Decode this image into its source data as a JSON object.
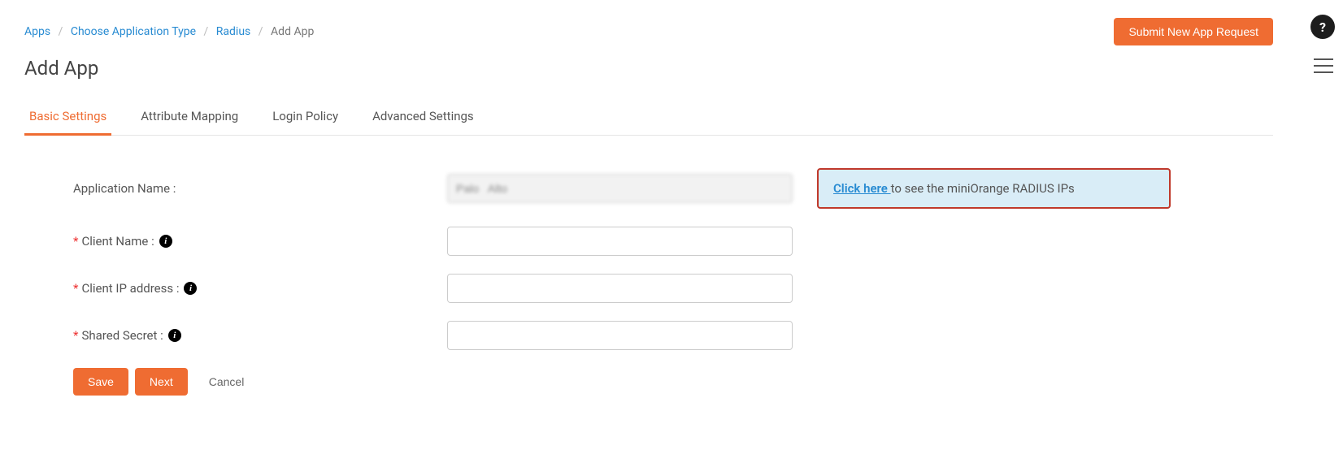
{
  "breadcrumb": {
    "items": [
      "Apps",
      "Choose Application Type",
      "Radius",
      "Add App"
    ]
  },
  "header": {
    "submit_btn": "Submit New App Request",
    "title": "Add App"
  },
  "tabs": [
    {
      "label": "Basic Settings"
    },
    {
      "label": "Attribute Mapping"
    },
    {
      "label": "Login Policy"
    },
    {
      "label": "Advanced Settings"
    }
  ],
  "form": {
    "app_name_label": "Application Name :",
    "app_name_value": "Palo   Alto",
    "client_name_label": "Client Name :",
    "client_name_value": "",
    "client_ip_label": "Client IP address :",
    "client_ip_value": "",
    "shared_secret_label": "Shared Secret :",
    "shared_secret_value": ""
  },
  "notice": {
    "link_text": "Click here ",
    "rest_text": "to see the miniOrange RADIUS IPs"
  },
  "buttons": {
    "save": "Save",
    "next": "Next",
    "cancel": "Cancel"
  },
  "icons": {
    "help": "?",
    "info": "i"
  }
}
